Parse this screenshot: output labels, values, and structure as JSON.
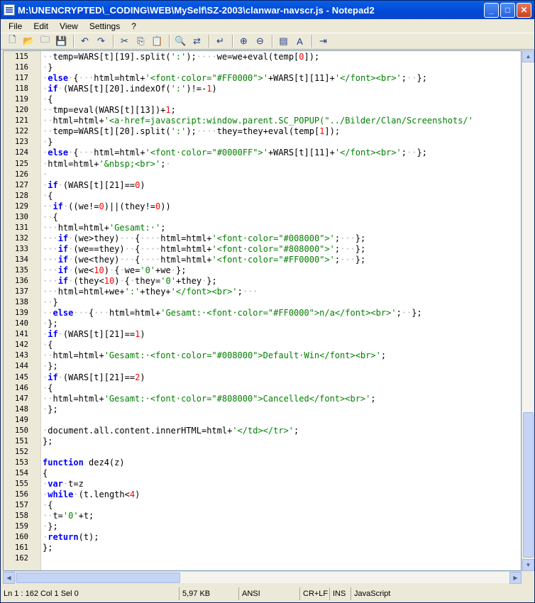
{
  "window": {
    "title": "M:\\UNENCRYPTED\\_CODING\\WEB\\MySelf\\SZ-2003\\clanwar-navscr.js - Notepad2"
  },
  "menu": [
    "File",
    "Edit",
    "View",
    "Settings",
    "?"
  ],
  "toolbar_icons": [
    "new-file-icon",
    "open-folder-icon",
    "browse-icon",
    "save-icon",
    "sep",
    "undo-icon",
    "redo-icon",
    "sep",
    "cut-icon",
    "copy-icon",
    "paste-icon",
    "sep",
    "find-icon",
    "replace-icon",
    "sep",
    "word-wrap-icon",
    "sep",
    "zoom-in-icon",
    "zoom-out-icon",
    "sep",
    "view-icon",
    "scheme-icon",
    "sep",
    "exit-icon"
  ],
  "code_lines": [
    {
      "ln": "115",
      "segs": [
        [
          "d",
          "··"
        ],
        [
          "o",
          "temp=WARS[t][19].split("
        ],
        [
          "s",
          "':'"
        ],
        [
          "o",
          ");"
        ],
        [
          "d",
          "····"
        ],
        [
          "o",
          "we=we+eval(temp["
        ],
        [
          "n",
          "0"
        ],
        [
          "o",
          "]);"
        ]
      ]
    },
    {
      "ln": "116",
      "segs": [
        [
          "d",
          "·"
        ],
        [
          "o",
          "}"
        ]
      ]
    },
    {
      "ln": "117",
      "segs": [
        [
          "d",
          "·"
        ],
        [
          "k",
          "else"
        ],
        [
          "d",
          "·"
        ],
        [
          "o",
          "{"
        ],
        [
          "d",
          "···"
        ],
        [
          "o",
          "html=html+"
        ],
        [
          "s",
          "'<font·color=\"#FF0000\">'"
        ],
        [
          "o",
          "+WARS[t][11]+"
        ],
        [
          "s",
          "'</font><br>'"
        ],
        [
          "o",
          ";"
        ],
        [
          "d",
          "··"
        ],
        [
          "o",
          "};"
        ]
      ]
    },
    {
      "ln": "118",
      "segs": [
        [
          "d",
          "·"
        ],
        [
          "k",
          "if"
        ],
        [
          "d",
          "·"
        ],
        [
          "o",
          "(WARS[t][20].indexOf("
        ],
        [
          "s",
          "':'"
        ],
        [
          "o",
          ")!=-"
        ],
        [
          "n",
          "1"
        ],
        [
          "o",
          ")"
        ]
      ]
    },
    {
      "ln": "119",
      "segs": [
        [
          "d",
          "·"
        ],
        [
          "o",
          "{"
        ]
      ]
    },
    {
      "ln": "120",
      "segs": [
        [
          "d",
          "··"
        ],
        [
          "o",
          "tmp=eval(WARS[t][13])+"
        ],
        [
          "n",
          "1"
        ],
        [
          "o",
          ";"
        ]
      ]
    },
    {
      "ln": "121",
      "segs": [
        [
          "d",
          "··"
        ],
        [
          "o",
          "html=html+"
        ],
        [
          "s",
          "'<a·href=javascript:window.parent.SC_POPUP(\"../Bilder/Clan/Screenshots/'"
        ]
      ]
    },
    {
      "ln": "122",
      "segs": [
        [
          "d",
          "··"
        ],
        [
          "o",
          "temp=WARS[t][20].split("
        ],
        [
          "s",
          "':'"
        ],
        [
          "o",
          ");"
        ],
        [
          "d",
          "····"
        ],
        [
          "o",
          "they=they+eval(temp["
        ],
        [
          "n",
          "1"
        ],
        [
          "o",
          "]);"
        ]
      ]
    },
    {
      "ln": "123",
      "segs": [
        [
          "d",
          "·"
        ],
        [
          "o",
          "}"
        ]
      ]
    },
    {
      "ln": "124",
      "segs": [
        [
          "d",
          "·"
        ],
        [
          "k",
          "else"
        ],
        [
          "d",
          "·"
        ],
        [
          "o",
          "{"
        ],
        [
          "d",
          "···"
        ],
        [
          "o",
          "html=html+"
        ],
        [
          "s",
          "'<font·color=\"#0000FF\">'"
        ],
        [
          "o",
          "+WARS[t][11]+"
        ],
        [
          "s",
          "'</font><br>'"
        ],
        [
          "o",
          ";"
        ],
        [
          "d",
          "··"
        ],
        [
          "o",
          "};"
        ]
      ]
    },
    {
      "ln": "125",
      "segs": [
        [
          "d",
          "·"
        ],
        [
          "o",
          "html=html+"
        ],
        [
          "s",
          "'&nbsp;<br>'"
        ],
        [
          "o",
          ";"
        ],
        [
          "d",
          "·"
        ]
      ]
    },
    {
      "ln": "126",
      "segs": [
        [
          "d",
          "·"
        ]
      ]
    },
    {
      "ln": "127",
      "segs": [
        [
          "d",
          "·"
        ],
        [
          "k",
          "if"
        ],
        [
          "d",
          "·"
        ],
        [
          "o",
          "(WARS[t][21]=="
        ],
        [
          "n",
          "0"
        ],
        [
          "o",
          ")"
        ]
      ]
    },
    {
      "ln": "128",
      "segs": [
        [
          "d",
          "·"
        ],
        [
          "o",
          "{"
        ]
      ]
    },
    {
      "ln": "129",
      "segs": [
        [
          "d",
          "··"
        ],
        [
          "k",
          "if"
        ],
        [
          "d",
          "·"
        ],
        [
          "o",
          "((we!="
        ],
        [
          "n",
          "0"
        ],
        [
          "o",
          ")||(they!="
        ],
        [
          "n",
          "0"
        ],
        [
          "o",
          "))"
        ]
      ]
    },
    {
      "ln": "130",
      "segs": [
        [
          "d",
          "··"
        ],
        [
          "o",
          "{"
        ]
      ]
    },
    {
      "ln": "131",
      "segs": [
        [
          "d",
          "···"
        ],
        [
          "o",
          "html=html+"
        ],
        [
          "s",
          "'Gesamt:·'"
        ],
        [
          "o",
          ";"
        ]
      ]
    },
    {
      "ln": "132",
      "segs": [
        [
          "d",
          "···"
        ],
        [
          "k",
          "if"
        ],
        [
          "d",
          "·"
        ],
        [
          "o",
          "(we>they)"
        ],
        [
          "d",
          "···"
        ],
        [
          "o",
          "{"
        ],
        [
          "d",
          "····"
        ],
        [
          "o",
          "html=html+"
        ],
        [
          "s",
          "'<font·color=\"#008000\">'"
        ],
        [
          "o",
          ";"
        ],
        [
          "d",
          "···"
        ],
        [
          "o",
          "};"
        ]
      ]
    },
    {
      "ln": "133",
      "segs": [
        [
          "d",
          "···"
        ],
        [
          "k",
          "if"
        ],
        [
          "d",
          "·"
        ],
        [
          "o",
          "(we==they)"
        ],
        [
          "d",
          "··"
        ],
        [
          "o",
          "{"
        ],
        [
          "d",
          "····"
        ],
        [
          "o",
          "html=html+"
        ],
        [
          "s",
          "'<font·color=\"#808000\">'"
        ],
        [
          "o",
          ";"
        ],
        [
          "d",
          "···"
        ],
        [
          "o",
          "};"
        ]
      ]
    },
    {
      "ln": "134",
      "segs": [
        [
          "d",
          "···"
        ],
        [
          "k",
          "if"
        ],
        [
          "d",
          "·"
        ],
        [
          "o",
          "(we<they)"
        ],
        [
          "d",
          "···"
        ],
        [
          "o",
          "{"
        ],
        [
          "d",
          "····"
        ],
        [
          "o",
          "html=html+"
        ],
        [
          "s",
          "'<font·color=\"#FF0000\">'"
        ],
        [
          "o",
          ";"
        ],
        [
          "d",
          "···"
        ],
        [
          "o",
          "};"
        ]
      ]
    },
    {
      "ln": "135",
      "segs": [
        [
          "d",
          "···"
        ],
        [
          "k",
          "if"
        ],
        [
          "d",
          "·"
        ],
        [
          "o",
          "(we<"
        ],
        [
          "n",
          "10"
        ],
        [
          "o",
          ")"
        ],
        [
          "d",
          "·"
        ],
        [
          "o",
          "{"
        ],
        [
          "d",
          "·"
        ],
        [
          "o",
          "we="
        ],
        [
          "s",
          "'0'"
        ],
        [
          "o",
          "+we"
        ],
        [
          "d",
          "·"
        ],
        [
          "o",
          "};"
        ]
      ]
    },
    {
      "ln": "136",
      "segs": [
        [
          "d",
          "···"
        ],
        [
          "k",
          "if"
        ],
        [
          "d",
          "·"
        ],
        [
          "o",
          "(they<"
        ],
        [
          "n",
          "10"
        ],
        [
          "o",
          ")"
        ],
        [
          "d",
          "·"
        ],
        [
          "o",
          "{"
        ],
        [
          "d",
          "·"
        ],
        [
          "o",
          "they="
        ],
        [
          "s",
          "'0'"
        ],
        [
          "o",
          "+they"
        ],
        [
          "d",
          "·"
        ],
        [
          "o",
          "};"
        ]
      ]
    },
    {
      "ln": "137",
      "segs": [
        [
          "d",
          "···"
        ],
        [
          "o",
          "html=html+we+"
        ],
        [
          "s",
          "':'"
        ],
        [
          "o",
          "+they+"
        ],
        [
          "s",
          "'</font><br>'"
        ],
        [
          "o",
          ";"
        ],
        [
          "d",
          "···"
        ]
      ]
    },
    {
      "ln": "138",
      "segs": [
        [
          "d",
          "··"
        ],
        [
          "o",
          "}"
        ]
      ]
    },
    {
      "ln": "139",
      "segs": [
        [
          "d",
          "··"
        ],
        [
          "k",
          "else"
        ],
        [
          "d",
          "···"
        ],
        [
          "o",
          "{"
        ],
        [
          "d",
          "···"
        ],
        [
          "o",
          "html=html+"
        ],
        [
          "s",
          "'Gesamt:·<font·color=\"#FF0000\">n/a</font><br>'"
        ],
        [
          "o",
          ";"
        ],
        [
          "d",
          "··"
        ],
        [
          "o",
          "};"
        ]
      ]
    },
    {
      "ln": "140",
      "segs": [
        [
          "d",
          "·"
        ],
        [
          "o",
          "};"
        ]
      ]
    },
    {
      "ln": "141",
      "segs": [
        [
          "d",
          "·"
        ],
        [
          "k",
          "if"
        ],
        [
          "d",
          "·"
        ],
        [
          "o",
          "(WARS[t][21]=="
        ],
        [
          "n",
          "1"
        ],
        [
          "o",
          ")"
        ]
      ]
    },
    {
      "ln": "142",
      "segs": [
        [
          "d",
          "·"
        ],
        [
          "o",
          "{"
        ]
      ]
    },
    {
      "ln": "143",
      "segs": [
        [
          "d",
          "··"
        ],
        [
          "o",
          "html=html+"
        ],
        [
          "s",
          "'Gesamt:·<font·color=\"#008000\">Default·Win</font><br>'"
        ],
        [
          "o",
          ";"
        ]
      ]
    },
    {
      "ln": "144",
      "segs": [
        [
          "d",
          "·"
        ],
        [
          "o",
          "};"
        ]
      ]
    },
    {
      "ln": "145",
      "segs": [
        [
          "d",
          "·"
        ],
        [
          "k",
          "if"
        ],
        [
          "d",
          "·"
        ],
        [
          "o",
          "(WARS[t][21]=="
        ],
        [
          "n",
          "2"
        ],
        [
          "o",
          ")"
        ]
      ]
    },
    {
      "ln": "146",
      "segs": [
        [
          "d",
          "·"
        ],
        [
          "o",
          "{"
        ]
      ]
    },
    {
      "ln": "147",
      "segs": [
        [
          "d",
          "··"
        ],
        [
          "o",
          "html=html+"
        ],
        [
          "s",
          "'Gesamt:·<font·color=\"#808000\">Cancelled</font><br>'"
        ],
        [
          "o",
          ";"
        ]
      ]
    },
    {
      "ln": "148",
      "segs": [
        [
          "d",
          "·"
        ],
        [
          "o",
          "};"
        ]
      ]
    },
    {
      "ln": "149",
      "segs": []
    },
    {
      "ln": "150",
      "segs": [
        [
          "d",
          "·"
        ],
        [
          "o",
          "document.all.content.innerHTML=html+"
        ],
        [
          "s",
          "'</td></tr>'"
        ],
        [
          "o",
          ";"
        ]
      ]
    },
    {
      "ln": "151",
      "segs": [
        [
          "o",
          "};"
        ]
      ]
    },
    {
      "ln": "152",
      "segs": []
    },
    {
      "ln": "153",
      "segs": [
        [
          "k",
          "function"
        ],
        [
          "o",
          " dez4(z)"
        ]
      ]
    },
    {
      "ln": "154",
      "segs": [
        [
          "o",
          "{"
        ]
      ]
    },
    {
      "ln": "155",
      "segs": [
        [
          "d",
          "·"
        ],
        [
          "k",
          "var"
        ],
        [
          "d",
          "·"
        ],
        [
          "o",
          "t=z"
        ]
      ]
    },
    {
      "ln": "156",
      "segs": [
        [
          "d",
          "·"
        ],
        [
          "k",
          "while"
        ],
        [
          "d",
          "·"
        ],
        [
          "o",
          "(t.length<"
        ],
        [
          "n",
          "4"
        ],
        [
          "o",
          ")"
        ]
      ]
    },
    {
      "ln": "157",
      "segs": [
        [
          "d",
          "·"
        ],
        [
          "o",
          "{"
        ]
      ]
    },
    {
      "ln": "158",
      "segs": [
        [
          "d",
          "··"
        ],
        [
          "o",
          "t="
        ],
        [
          "s",
          "'0'"
        ],
        [
          "o",
          "+t;"
        ]
      ]
    },
    {
      "ln": "159",
      "segs": [
        [
          "d",
          "·"
        ],
        [
          "o",
          "};"
        ]
      ]
    },
    {
      "ln": "160",
      "segs": [
        [
          "d",
          "·"
        ],
        [
          "k",
          "return"
        ],
        [
          "o",
          "(t);"
        ]
      ]
    },
    {
      "ln": "161",
      "segs": [
        [
          "o",
          "};"
        ]
      ]
    },
    {
      "ln": "162",
      "segs": []
    }
  ],
  "status": {
    "pos": "Ln 1 : 162   Col 1   Sel 0",
    "size": "5,97 KB",
    "encoding": "ANSI",
    "eol": "CR+LF",
    "ins": "INS",
    "lang": "JavaScript"
  }
}
